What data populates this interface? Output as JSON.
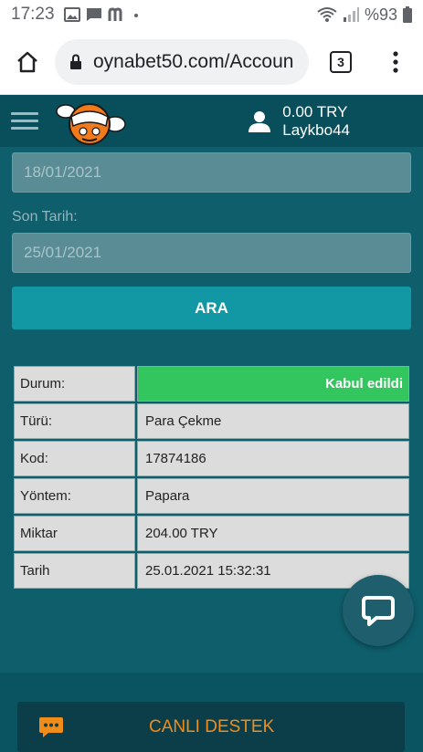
{
  "status_bar": {
    "time": "17:23",
    "battery": "%93",
    "app_icons": [
      "image-icon",
      "chat-bubble-icon",
      "m-app-icon",
      "dot-icon"
    ]
  },
  "browser": {
    "url": "oynabet50.com/Accoun",
    "tab_count": "3"
  },
  "header": {
    "balance": "0.00 TRY",
    "username": "Laykbo44"
  },
  "filter": {
    "start_date": "18/01/2021",
    "end_date_label": "Son Tarih:",
    "end_date": "25/01/2021",
    "search_button": "ARA"
  },
  "details": {
    "status_label": "Durum:",
    "status_value": "Kabul edildi",
    "type_label": "Türü:",
    "type_value": "Para Çekme",
    "code_label": "Kod:",
    "code_value": "17874186",
    "method_label": "Yöntem:",
    "method_value": "Papara",
    "amount_label": "Miktar",
    "amount_value": "204.00 TRY",
    "date_label": "Tarih",
    "date_value": "25.01.2021 15:32:31"
  },
  "footer": {
    "live_support": "CANLI DESTEK"
  },
  "colors": {
    "accent": "#1198a4",
    "status_ok": "#33c65e",
    "support_text": "#f08c1a",
    "background": "#0e5e6b"
  }
}
